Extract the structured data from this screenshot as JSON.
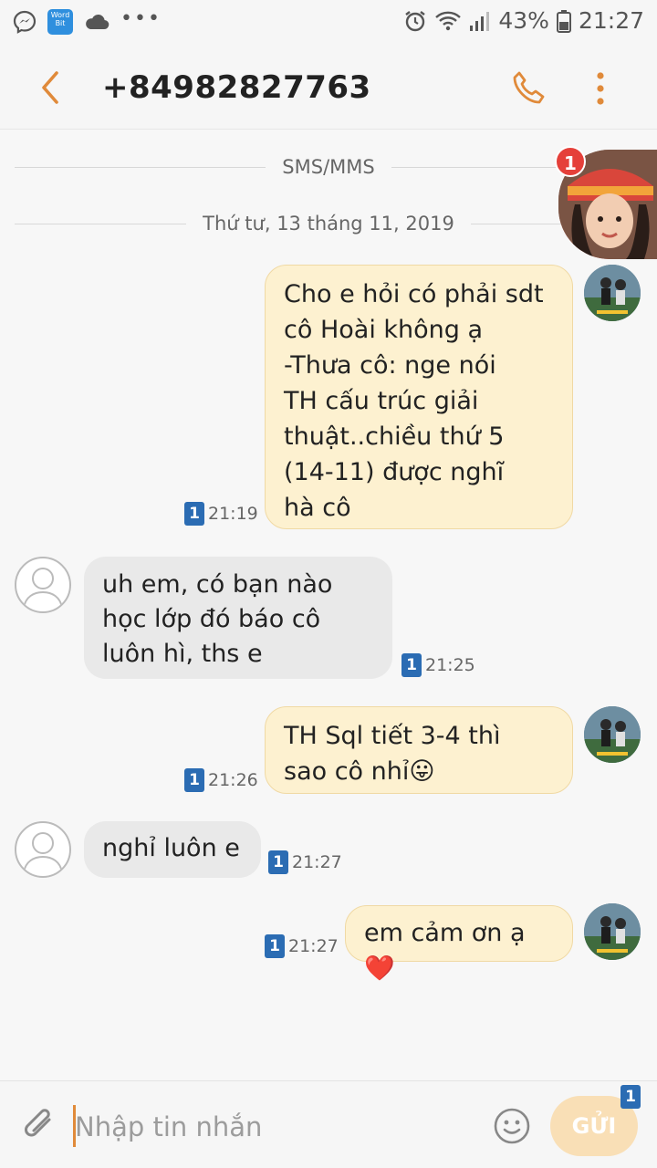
{
  "status_bar": {
    "battery": "43%",
    "time": "21:27",
    "wordbit_label": "Word Bit"
  },
  "header": {
    "contact": "+84982827763"
  },
  "conversation": {
    "channel": "SMS/MMS",
    "date": "Thứ tư, 13 tháng 11, 2019",
    "messages": [
      {
        "direction": "out",
        "sim": "1",
        "time": "21:19",
        "text": " Cho e hỏi có phải sdt\ncô Hoài không ạ\n-Thưa cô: nge nói\nTH cấu trúc giải\nthuật..chiều thứ 5\n(14-11) được nghĩ\nhà cô"
      },
      {
        "direction": "in",
        "sim": "1",
        "time": "21:25",
        "text": "uh em, có bạn nào\nhọc lớp đó báo cô\nluôn hì, ths e"
      },
      {
        "direction": "out",
        "sim": "1",
        "time": "21:26",
        "text": "TH Sql tiết 3-4  thì\nsao cô nhỉ😛"
      },
      {
        "direction": "in",
        "sim": "1",
        "time": "21:27",
        "text": "nghỉ luôn e"
      },
      {
        "direction": "out",
        "sim": "1",
        "time": "21:27",
        "text": "em cảm ơn ạ❤️"
      }
    ]
  },
  "chat_head": {
    "badge": "1"
  },
  "input_bar": {
    "placeholder": "Nhập tin nhắn",
    "send_label": "GỬI",
    "sim": "1"
  },
  "colors": {
    "accent": "#e08a3a",
    "outgoing_bubble": "#fdf1d0",
    "incoming_bubble": "#e9e9e9",
    "sim_badge": "#2b6cb3"
  }
}
